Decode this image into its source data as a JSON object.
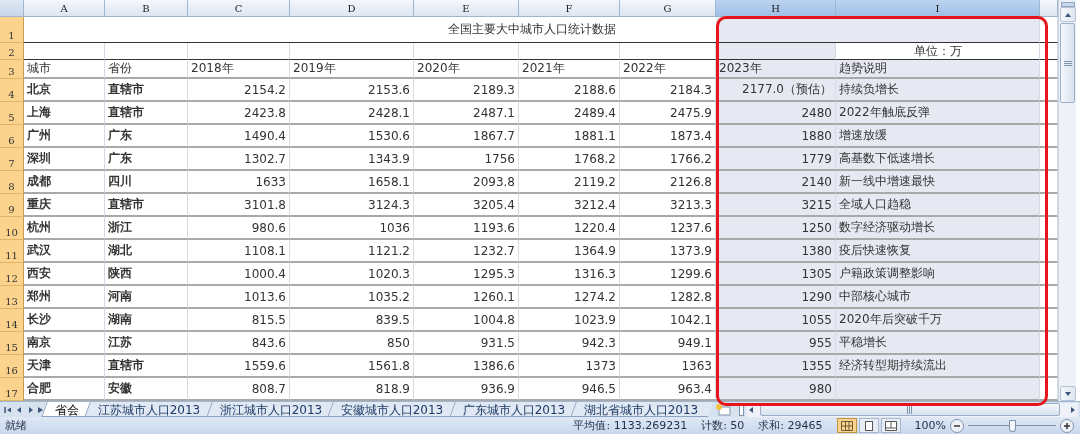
{
  "columns": [
    {
      "letter": "A",
      "selected": false
    },
    {
      "letter": "B",
      "selected": false
    },
    {
      "letter": "C",
      "selected": false
    },
    {
      "letter": "D",
      "selected": false
    },
    {
      "letter": "E",
      "selected": false
    },
    {
      "letter": "F",
      "selected": false
    },
    {
      "letter": "G",
      "selected": false
    },
    {
      "letter": "H",
      "selected": true
    },
    {
      "letter": "I",
      "selected": true
    }
  ],
  "title_row": {
    "number": "1",
    "selected": true,
    "title": "全国主要大中城市人口统计数据"
  },
  "unit_row": {
    "number": "2",
    "selected": true,
    "unit": "单位：万",
    "unit_active": true
  },
  "header_row": {
    "number": "3",
    "selected": true,
    "labels": [
      "城市",
      "省份",
      "2018年",
      "2019年",
      "2020年",
      "2021年",
      "2022年",
      "2023年",
      "趋势说明"
    ]
  },
  "data_rows": [
    {
      "number": "4",
      "selected": true,
      "cells": [
        "北京",
        "直辖市",
        "2154.2",
        "2153.6",
        "2189.3",
        "2188.6",
        "2184.3",
        "2177.0（预估）",
        "持续负增长"
      ]
    },
    {
      "number": "5",
      "selected": true,
      "cells": [
        "上海",
        "直辖市",
        "2423.8",
        "2428.1",
        "2487.1",
        "2489.4",
        "2475.9",
        "2480",
        "2022年触底反弹"
      ]
    },
    {
      "number": "6",
      "selected": true,
      "cells": [
        "广州",
        "广东",
        "1490.4",
        "1530.6",
        "1867.7",
        "1881.1",
        "1873.4",
        "1880",
        "增速放缓"
      ]
    },
    {
      "number": "7",
      "selected": true,
      "cells": [
        "深圳",
        "广东",
        "1302.7",
        "1343.9",
        "1756",
        "1768.2",
        "1766.2",
        "1779",
        "高基数下低速增长"
      ]
    },
    {
      "number": "8",
      "selected": true,
      "cells": [
        "成都",
        "四川",
        "1633",
        "1658.1",
        "2093.8",
        "2119.2",
        "2126.8",
        "2140",
        "新一线中增速最快"
      ]
    },
    {
      "number": "9",
      "selected": true,
      "cells": [
        "重庆",
        "直辖市",
        "3101.8",
        "3124.3",
        "3205.4",
        "3212.4",
        "3213.3",
        "3215",
        "全域人口趋稳"
      ]
    },
    {
      "number": "10",
      "selected": true,
      "cells": [
        "杭州",
        "浙江",
        "980.6",
        "1036",
        "1193.6",
        "1220.4",
        "1237.6",
        "1250",
        "数字经济驱动增长"
      ]
    },
    {
      "number": "11",
      "selected": true,
      "cells": [
        "武汉",
        "湖北",
        "1108.1",
        "1121.2",
        "1232.7",
        "1364.9",
        "1373.9",
        "1380",
        "疫后快速恢复"
      ]
    },
    {
      "number": "12",
      "selected": true,
      "cells": [
        "西安",
        "陕西",
        "1000.4",
        "1020.3",
        "1295.3",
        "1316.3",
        "1299.6",
        "1305",
        "户籍政策调整影响"
      ]
    },
    {
      "number": "13",
      "selected": true,
      "cells": [
        "郑州",
        "河南",
        "1013.6",
        "1035.2",
        "1260.1",
        "1274.2",
        "1282.8",
        "1290",
        "中部核心城市"
      ]
    },
    {
      "number": "14",
      "selected": true,
      "cells": [
        "长沙",
        "湖南",
        "815.5",
        "839.5",
        "1004.8",
        "1023.9",
        "1042.1",
        "1055",
        "2020年后突破千万"
      ]
    },
    {
      "number": "15",
      "selected": true,
      "cells": [
        "南京",
        "江苏",
        "843.6",
        "850",
        "931.5",
        "942.3",
        "949.1",
        "955",
        "平稳增长"
      ]
    },
    {
      "number": "16",
      "selected": true,
      "cells": [
        "天津",
        "直辖市",
        "1559.6",
        "1561.8",
        "1386.6",
        "1373",
        "1363",
        "1355",
        "经济转型期持续流出"
      ]
    },
    {
      "number": "17",
      "selected": true,
      "cells": [
        "合肥",
        "安徽",
        "808.7",
        "818.9",
        "936.9",
        "946.5",
        "963.4",
        "980"
      ]
    }
  ],
  "sheet_tabs": [
    {
      "label": "省会",
      "selected": true
    },
    {
      "label": "江苏城市人口2013",
      "selected": false
    },
    {
      "label": "浙江城市人口2013",
      "selected": false
    },
    {
      "label": "安徽城市人口2013",
      "selected": false
    },
    {
      "label": "广东城市人口2013",
      "selected": false
    },
    {
      "label": "湖北省城市人口2013",
      "selected": false
    }
  ],
  "status_bar": {
    "mode": "就绪",
    "average": "平均值: 1133.269231",
    "count": "计数: 50",
    "sum": "求和: 29465",
    "views": [
      {
        "kind": "normal",
        "selected": true
      },
      {
        "kind": "layout",
        "selected": false
      },
      {
        "kind": "pagebreak",
        "selected": false
      }
    ],
    "zoom": "100%",
    "zoom_slider": {
      "level": 0.5
    }
  }
}
